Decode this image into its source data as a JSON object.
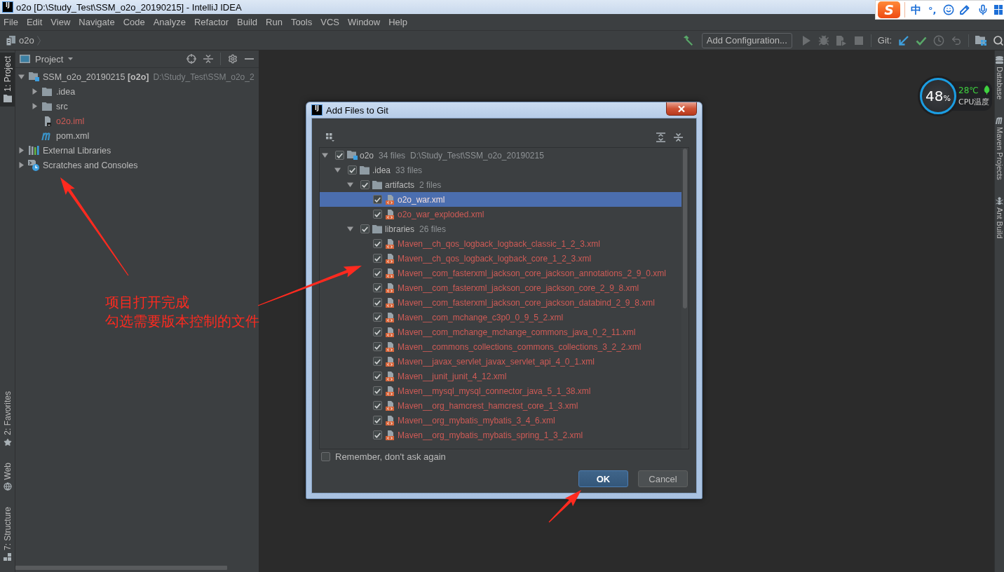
{
  "title_bar": {
    "app_icon": "IJ",
    "title": "o2o [D:\\Study_Test\\SSM_o2o_20190215] - IntelliJ IDEA"
  },
  "ime_toolbar": {
    "logo": "S",
    "mode": "中",
    "punctuation": "°,"
  },
  "menu": [
    "File",
    "Edit",
    "View",
    "Navigate",
    "Code",
    "Analyze",
    "Refactor",
    "Build",
    "Run",
    "Tools",
    "VCS",
    "Window",
    "Help"
  ],
  "nav_bar": {
    "breadcrumb": "o2o",
    "run_configuration": "Add Configuration...",
    "run_actions_disabled": true,
    "vcs_label": "Git:"
  },
  "left_stripe": {
    "top": [
      {
        "label": "1: Project",
        "selected": true
      }
    ],
    "bottom": [
      {
        "label": "2: Favorites",
        "selected": false
      },
      {
        "label": "Web",
        "selected": false
      },
      {
        "label": "7: Structure",
        "selected": false
      }
    ]
  },
  "project_panel": {
    "title": "Project",
    "tree": [
      {
        "name": "SSM_o2o_20190215 **[o2o]**",
        "path": "D:\\Study_Test\\SSM_o2o_2",
        "kind": "module",
        "expanded": true,
        "unversioned": false,
        "children": [
          {
            "name": ".idea",
            "kind": "folder",
            "expanded": false,
            "unversioned": false
          },
          {
            "name": "src",
            "kind": "folder",
            "expanded": false,
            "unversioned": false
          },
          {
            "name": "o2o.iml",
            "kind": "iml",
            "unversioned": true
          },
          {
            "name": "pom.xml",
            "kind": "maven",
            "unversioned": false
          }
        ]
      },
      {
        "name": "External Libraries",
        "kind": "libraries",
        "expanded": false,
        "unversioned": false
      },
      {
        "name": "Scratches and Consoles",
        "kind": "scratches",
        "expanded": false,
        "unversioned": false
      }
    ]
  },
  "annotations": [
    "项目打开完成",
    "勾选需要版本控制的文件"
  ],
  "right_stripe": [
    {
      "label": "Database"
    },
    {
      "label": "Maven Projects"
    },
    {
      "label": "Ant Build"
    }
  ],
  "cpu_widget": {
    "value": "48",
    "unit": "%",
    "temperature": "28℃",
    "label": "CPU温度"
  },
  "dialog": {
    "app_icon": "IJ",
    "title": "Add Files to Git",
    "tree": [
      {
        "name": "o2o",
        "kind": "module",
        "count": "34 files",
        "path": "D:\\Study_Test\\SSM_o2o_20190215",
        "checked": true,
        "expanded": true,
        "selected": false,
        "unversioned": false,
        "children": [
          {
            "name": ".idea",
            "kind": "folder",
            "count": "33 files",
            "checked": true,
            "expanded": true,
            "selected": false,
            "unversioned": false,
            "children": [
              {
                "name": "artifacts",
                "kind": "folder",
                "count": "2 files",
                "checked": true,
                "expanded": true,
                "selected": false,
                "unversioned": false,
                "children": [
                  {
                    "name": "o2o_war.xml",
                    "kind": "xml",
                    "checked": true,
                    "selected": true,
                    "unversioned": true
                  },
                  {
                    "name": "o2o_war_exploded.xml",
                    "kind": "xml",
                    "checked": true,
                    "selected": false,
                    "unversioned": true
                  }
                ]
              },
              {
                "name": "libraries",
                "kind": "folder",
                "count": "26 files",
                "checked": true,
                "expanded": true,
                "selected": false,
                "unversioned": false,
                "children": [
                  {
                    "name": "Maven__ch_qos_logback_logback_classic_1_2_3.xml",
                    "kind": "xml",
                    "checked": true,
                    "selected": false,
                    "unversioned": true
                  },
                  {
                    "name": "Maven__ch_qos_logback_logback_core_1_2_3.xml",
                    "kind": "xml",
                    "checked": true,
                    "selected": false,
                    "unversioned": true
                  },
                  {
                    "name": "Maven__com_fasterxml_jackson_core_jackson_annotations_2_9_0.xml",
                    "kind": "xml",
                    "checked": true,
                    "selected": false,
                    "unversioned": true
                  },
                  {
                    "name": "Maven__com_fasterxml_jackson_core_jackson_core_2_9_8.xml",
                    "kind": "xml",
                    "checked": true,
                    "selected": false,
                    "unversioned": true
                  },
                  {
                    "name": "Maven__com_fasterxml_jackson_core_jackson_databind_2_9_8.xml",
                    "kind": "xml",
                    "checked": true,
                    "selected": false,
                    "unversioned": true
                  },
                  {
                    "name": "Maven__com_mchange_c3p0_0_9_5_2.xml",
                    "kind": "xml",
                    "checked": true,
                    "selected": false,
                    "unversioned": true
                  },
                  {
                    "name": "Maven__com_mchange_mchange_commons_java_0_2_11.xml",
                    "kind": "xml",
                    "checked": true,
                    "selected": false,
                    "unversioned": true
                  },
                  {
                    "name": "Maven__commons_collections_commons_collections_3_2_2.xml",
                    "kind": "xml",
                    "checked": true,
                    "selected": false,
                    "unversioned": true
                  },
                  {
                    "name": "Maven__javax_servlet_javax_servlet_api_4_0_1.xml",
                    "kind": "xml",
                    "checked": true,
                    "selected": false,
                    "unversioned": true
                  },
                  {
                    "name": "Maven__junit_junit_4_12.xml",
                    "kind": "xml",
                    "checked": true,
                    "selected": false,
                    "unversioned": true
                  },
                  {
                    "name": "Maven__mysql_mysql_connector_java_5_1_38.xml",
                    "kind": "xml",
                    "checked": true,
                    "selected": false,
                    "unversioned": true
                  },
                  {
                    "name": "Maven__org_hamcrest_hamcrest_core_1_3.xml",
                    "kind": "xml",
                    "checked": true,
                    "selected": false,
                    "unversioned": true
                  },
                  {
                    "name": "Maven__org_mybatis_mybatis_3_4_6.xml",
                    "kind": "xml",
                    "checked": true,
                    "selected": false,
                    "unversioned": true
                  },
                  {
                    "name": "Maven__org_mybatis_mybatis_spring_1_3_2.xml",
                    "kind": "xml",
                    "checked": true,
                    "selected": false,
                    "unversioned": true
                  }
                ]
              }
            ]
          }
        ]
      }
    ],
    "remember": {
      "label": "Remember, don't ask again",
      "checked": false
    },
    "buttons": [
      {
        "label": "OK",
        "default": true
      },
      {
        "label": "Cancel",
        "default": false
      }
    ]
  }
}
